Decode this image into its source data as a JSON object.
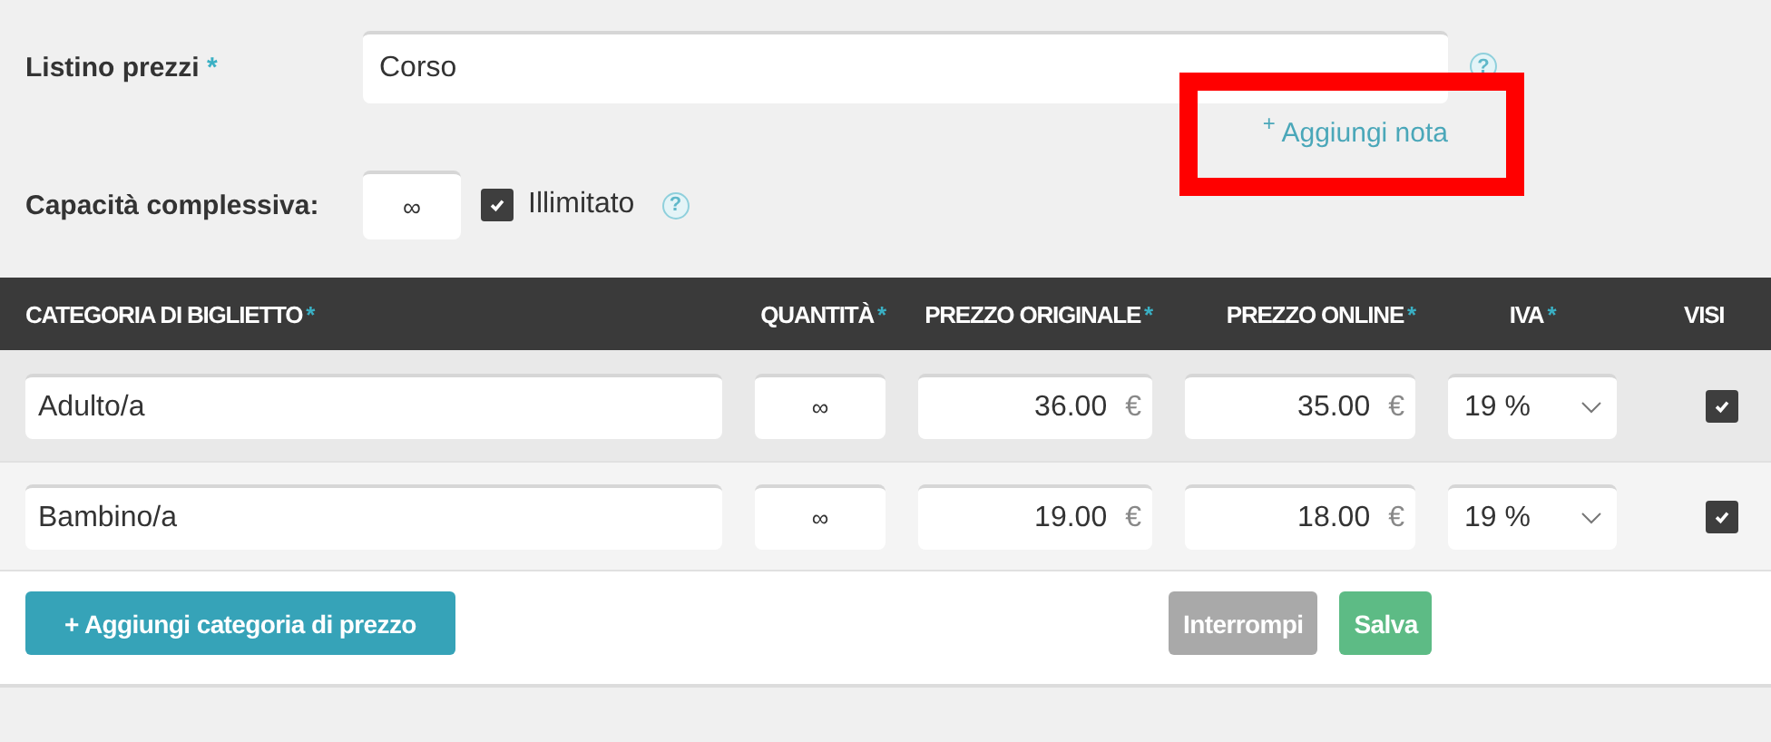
{
  "price_list": {
    "label": "Listino prezzi",
    "required_mark": "*",
    "value": "Corso",
    "help": "?",
    "add_note": "$^{+}$ Aggiungi nota"
  },
  "capacity": {
    "label": "Capacità complessiva:",
    "value": "∞",
    "unlimited": {
      "label": "Illimitato",
      "checked": true
    },
    "help": "?"
  },
  "table": {
    "columns": [
      {
        "label": "CATEGORIA DI BIGLIETTO",
        "required_mark": "*"
      },
      {
        "label": "QUANTITÀ",
        "required_mark": "*"
      },
      {
        "label": "PREZZO ORIGINALE",
        "required_mark": "*"
      },
      {
        "label": "PREZZO ONLINE",
        "required_mark": "*"
      },
      {
        "label": "IVA",
        "required_mark": "*"
      },
      {
        "label": "VISI"
      }
    ],
    "rows": [
      {
        "category": "Adulto/a",
        "quantity": "∞",
        "original_price": "36.00",
        "original_currency": "€",
        "online_price": "35.00",
        "online_currency": "€",
        "vat": "19 %",
        "visible": true
      },
      {
        "category": "Bambino/a",
        "quantity": "∞",
        "original_price": "19.00",
        "original_currency": "€",
        "online_price": "18.00",
        "online_currency": "€",
        "vat": "19 %",
        "visible": true
      }
    ]
  },
  "add_category": "+ Aggiungi categoria di prezzo",
  "buttons": [
    {
      "label": "Interrompi",
      "kind": "secondary"
    },
    {
      "label": "Salva",
      "kind": "primary"
    }
  ]
}
